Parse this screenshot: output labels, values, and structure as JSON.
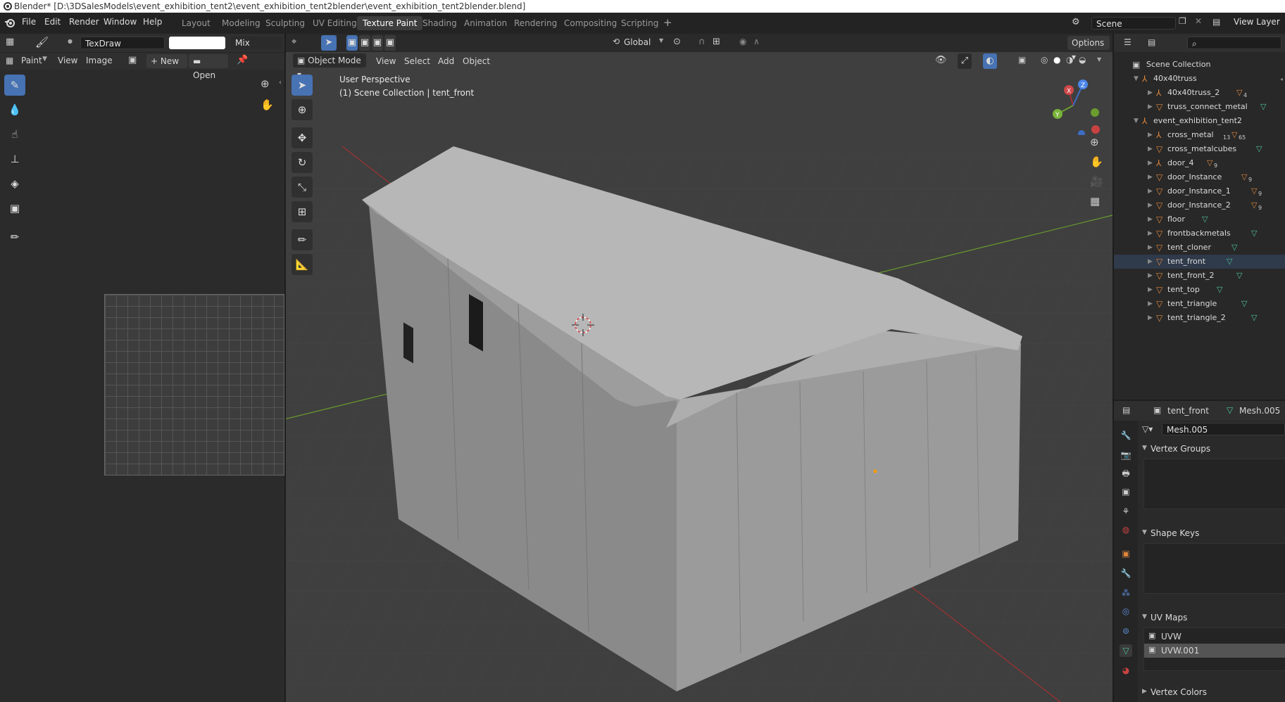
{
  "window": {
    "title": "Blender* [D:\\3DSalesModels\\event_exhibition_tent2\\event_exhibition_tent2blender\\event_exhibition_tent2blender.blend]"
  },
  "menu": {
    "file": "File",
    "edit": "Edit",
    "render": "Render",
    "window": "Window",
    "help": "Help"
  },
  "workspaces": [
    "Layout",
    "Modeling",
    "Sculpting",
    "UV Editing",
    "Texture Paint",
    "Shading",
    "Animation",
    "Rendering",
    "Compositing",
    "Scripting"
  ],
  "active_workspace": "Texture Paint",
  "scene": {
    "name": "Scene",
    "view_layer": "View Layer"
  },
  "paint_header": {
    "brush_name": "TexDraw",
    "blend": "Mix"
  },
  "image_header": {
    "paint": "Paint",
    "view": "View",
    "image": "Image",
    "new": "New",
    "open": "Open"
  },
  "viewport": {
    "mode": "Object Mode",
    "menus": [
      "View",
      "Select",
      "Add",
      "Object"
    ],
    "orientation": "Global",
    "options": "Options",
    "overlay_line1": "User Perspective",
    "overlay_line2": "(1) Scene Collection | tent_front",
    "gizmo": {
      "x": "X",
      "y": "Y",
      "z": "Z"
    }
  },
  "outliner": {
    "root": "Scene Collection",
    "items": [
      {
        "label": "40x40truss",
        "depth": 1,
        "kind": "empty",
        "badge": ""
      },
      {
        "label": "40x40truss_2",
        "depth": 2,
        "kind": "empty",
        "badge": "4"
      },
      {
        "label": "truss_connect_metal",
        "depth": 2,
        "kind": "mesh",
        "badge": ""
      },
      {
        "label": "event_exhibition_tent2",
        "depth": 1,
        "kind": "empty",
        "badge": ""
      },
      {
        "label": "cross_metal",
        "depth": 2,
        "kind": "empty",
        "badge": "65"
      },
      {
        "label": "cross_metalcubes",
        "depth": 2,
        "kind": "mesh",
        "badge": ""
      },
      {
        "label": "door_4",
        "depth": 2,
        "kind": "empty",
        "badge": "9"
      },
      {
        "label": "door_Instance",
        "depth": 2,
        "kind": "mesh",
        "badge": "9"
      },
      {
        "label": "door_Instance_1",
        "depth": 2,
        "kind": "mesh",
        "badge": "9"
      },
      {
        "label": "door_Instance_2",
        "depth": 2,
        "kind": "mesh",
        "badge": "9"
      },
      {
        "label": "floor",
        "depth": 2,
        "kind": "mesh",
        "badge": ""
      },
      {
        "label": "frontbackmetals",
        "depth": 2,
        "kind": "mesh",
        "badge": ""
      },
      {
        "label": "tent_cloner",
        "depth": 2,
        "kind": "mesh",
        "badge": ""
      },
      {
        "label": "tent_front",
        "depth": 2,
        "kind": "mesh",
        "badge": ""
      },
      {
        "label": "tent_front_2",
        "depth": 2,
        "kind": "mesh",
        "badge": ""
      },
      {
        "label": "tent_top",
        "depth": 2,
        "kind": "mesh",
        "badge": ""
      },
      {
        "label": "tent_triangle",
        "depth": 2,
        "kind": "mesh",
        "badge": ""
      },
      {
        "label": "tent_triangle_2",
        "depth": 2,
        "kind": "mesh",
        "badge": ""
      }
    ],
    "badge_extra": {
      "cross_metal_left": "13"
    }
  },
  "properties": {
    "object": "tent_front",
    "mesh": "Mesh.005",
    "datablock": "Mesh.005",
    "sections": {
      "vertex_groups": "Vertex Groups",
      "shape_keys": "Shape Keys",
      "uv_maps": "UV Maps",
      "vertex_colors": "Vertex Colors"
    },
    "uv_maps": [
      "UVW",
      "UVW.001"
    ],
    "active_uv": "UVW.001"
  },
  "colors": {
    "accent": "#4772b3",
    "object_orange": "#e0873c",
    "mesh_green": "#4fc3a0",
    "axis_red": "#a03232",
    "axis_green": "#6b9c2e"
  }
}
